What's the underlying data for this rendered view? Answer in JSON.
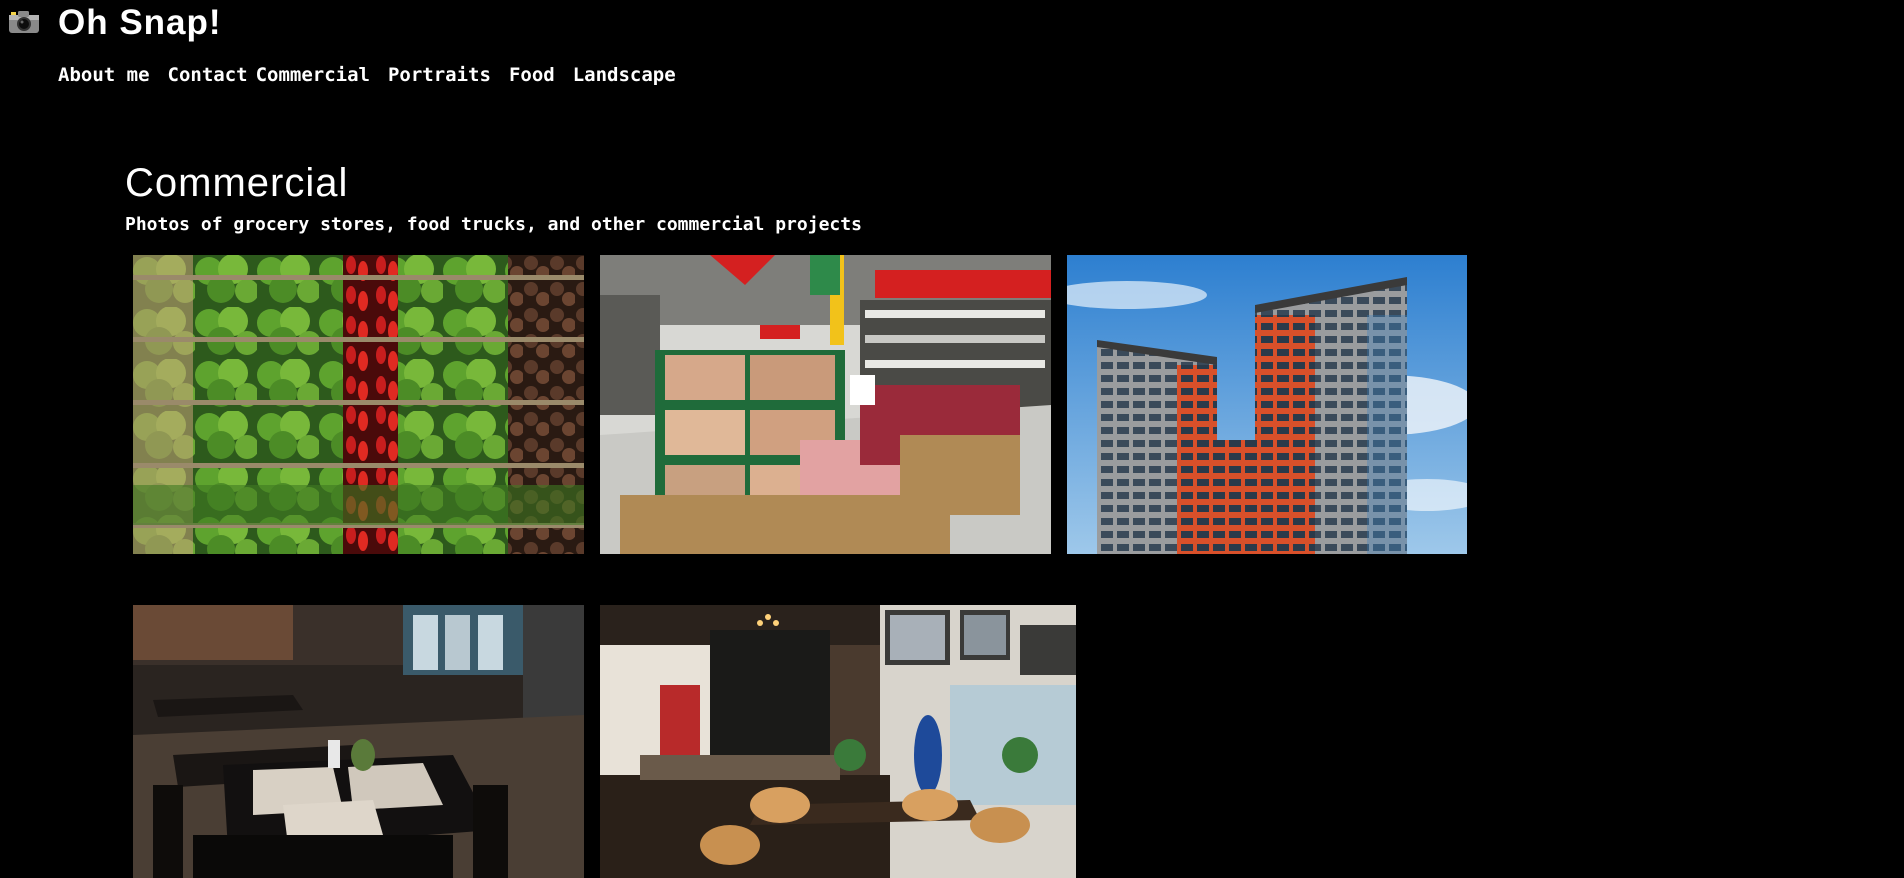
{
  "site": {
    "title": "Oh Snap!",
    "icon": "camera-icon"
  },
  "nav": {
    "items": [
      {
        "label": "About me"
      },
      {
        "label": "Contact"
      },
      {
        "label": "Commercial"
      },
      {
        "label": "Portraits"
      },
      {
        "label": "Food"
      },
      {
        "label": "Landscape"
      }
    ]
  },
  "section": {
    "heading": "Commercial",
    "subtitle": "Photos of grocery stores, food trucks, and other commercial projects"
  },
  "gallery": {
    "photos": [
      {
        "subject": "grocery-produce-shelves"
      },
      {
        "subject": "supermarket-produce-aisle"
      },
      {
        "subject": "apartment-tower-blue-sky"
      },
      {
        "subject": "restaurant-dining-tables"
      },
      {
        "subject": "cafe-interior"
      }
    ]
  },
  "colors": {
    "background": "#000000",
    "text": "#ffffff"
  }
}
